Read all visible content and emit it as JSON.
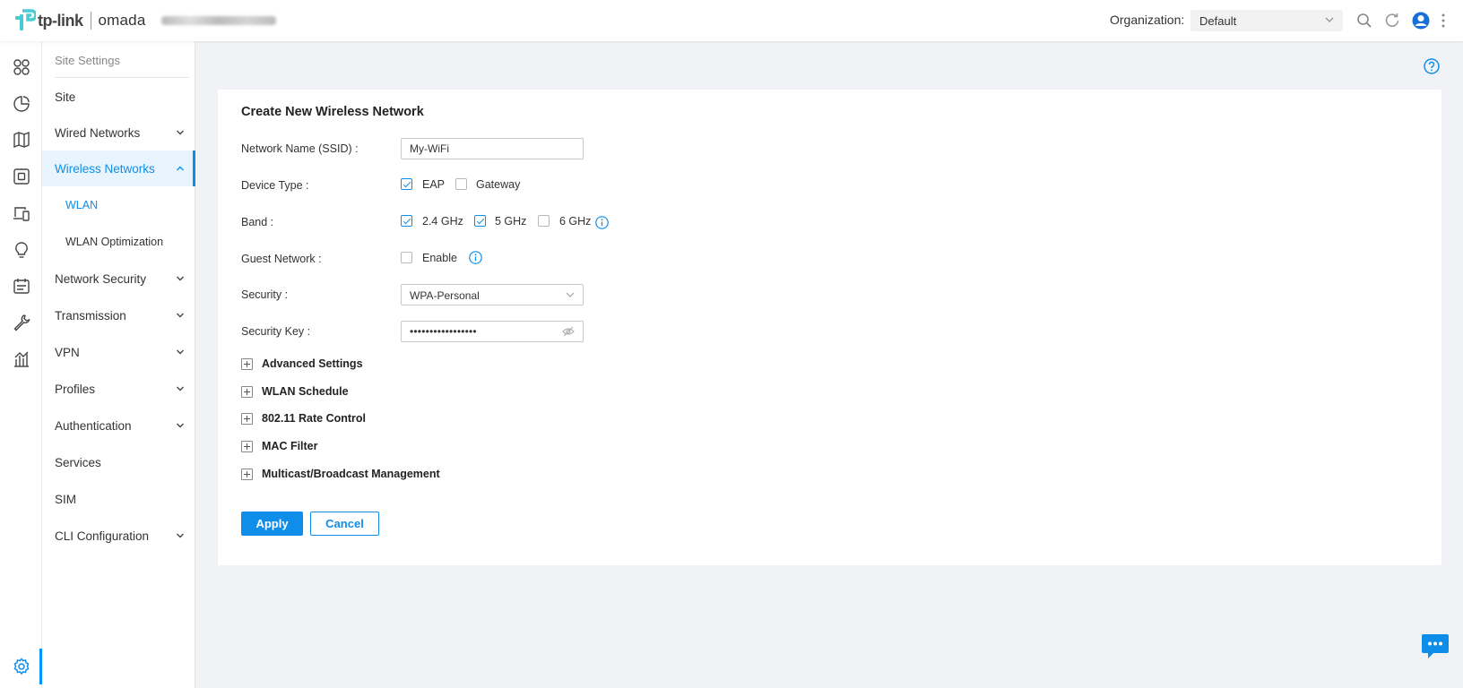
{
  "header": {
    "brand_tp": "tp-link",
    "brand_omada": "omada",
    "org_label": "Organization:",
    "org_value": "Default"
  },
  "submenu": {
    "title": "Site Settings",
    "items": [
      {
        "label": "Site"
      },
      {
        "label": "Wired Networks"
      },
      {
        "label": "Wireless Networks"
      },
      {
        "label": "WLAN"
      },
      {
        "label": "WLAN Optimization"
      },
      {
        "label": "Network Security"
      },
      {
        "label": "Transmission"
      },
      {
        "label": "VPN"
      },
      {
        "label": "Profiles"
      },
      {
        "label": "Authentication"
      },
      {
        "label": "Services"
      },
      {
        "label": "SIM"
      },
      {
        "label": "CLI Configuration"
      }
    ]
  },
  "form": {
    "title": "Create New Wireless Network",
    "ssid_label": "Network Name (SSID) :",
    "ssid_value": "My-WiFi",
    "device_type_label": "Device Type :",
    "device_eap": "EAP",
    "device_gateway": "Gateway",
    "band_label": "Band :",
    "band_24": "2.4 GHz",
    "band_5": "5 GHz",
    "band_6": "6 GHz",
    "guest_label": "Guest Network :",
    "guest_enable": "Enable",
    "security_label": "Security :",
    "security_value": "WPA-Personal",
    "key_label": "Security Key :",
    "key_value": "•••••••••••••••••",
    "sections": [
      {
        "label": "Advanced Settings"
      },
      {
        "label": "WLAN Schedule"
      },
      {
        "label": "802.11 Rate Control"
      },
      {
        "label": "MAC Filter"
      },
      {
        "label": "Multicast/Broadcast Management"
      }
    ],
    "apply": "Apply",
    "cancel": "Cancel"
  },
  "colors": {
    "accent": "#0f8ee9",
    "background": "#f0f2f5"
  }
}
